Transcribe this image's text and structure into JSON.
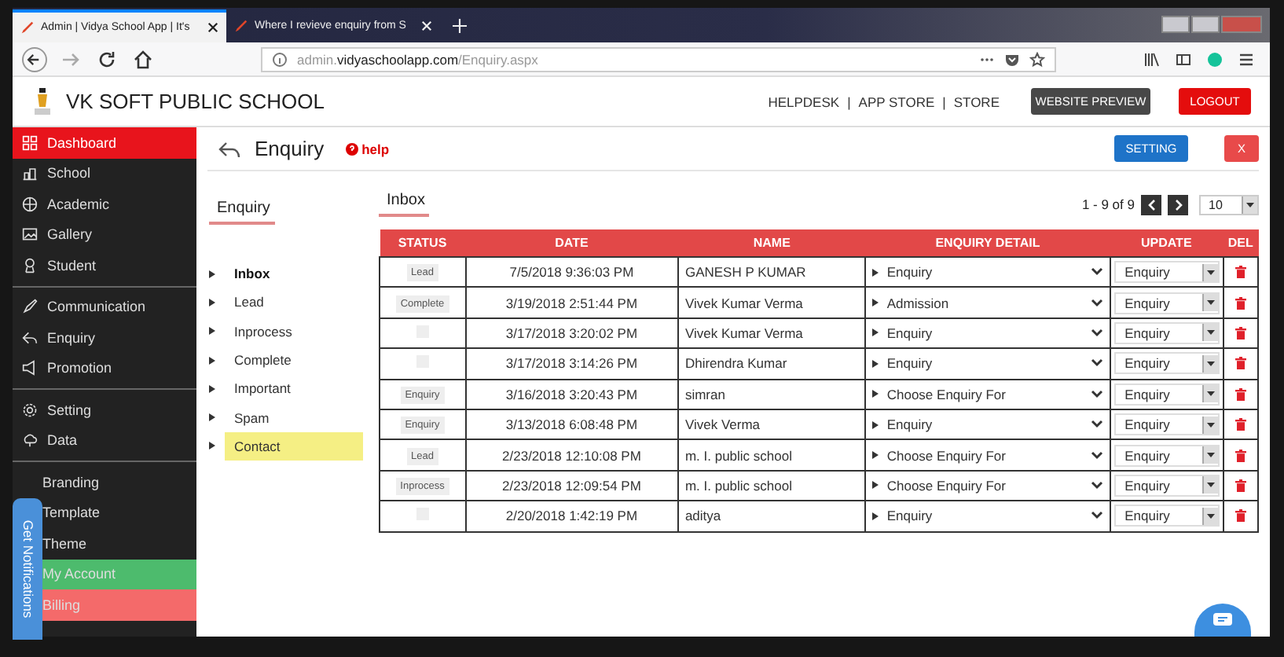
{
  "browser": {
    "tabs": [
      {
        "title": "Admin | Vidya School App | It's",
        "selected": true
      },
      {
        "title": "Where I revieve enquiry from S",
        "selected": false
      }
    ],
    "url": {
      "host": "admin.",
      "domain": "vidyaschoolapp.com",
      "path": "/Enquiry.aspx"
    }
  },
  "header": {
    "school_name": "VK SOFT PUBLIC SCHOOL",
    "links": [
      "HELPDESK",
      "APP STORE",
      "STORE"
    ],
    "separator": "|",
    "preview_button": "WEBSITE PREVIEW",
    "logout_button": "LOGOUT"
  },
  "sidebar": {
    "groups": [
      {
        "items": [
          {
            "label": "Dashboard",
            "selected": true,
            "color": "#e8141c"
          },
          {
            "label": "School",
            "selected": false
          },
          {
            "label": "Academic",
            "selected": false
          },
          {
            "label": "Gallery",
            "selected": false
          },
          {
            "label": "Student",
            "selected": false
          }
        ]
      },
      {
        "items": [
          {
            "label": "Communication",
            "selected": false
          },
          {
            "label": "Enquiry",
            "selected": false
          },
          {
            "label": "Promotion",
            "selected": false
          }
        ]
      },
      {
        "items": [
          {
            "label": "Setting",
            "selected": false
          },
          {
            "label": "Data",
            "selected": false
          }
        ]
      },
      {
        "items": [
          {
            "label": "Branding",
            "selected": false
          },
          {
            "label": "Template",
            "selected": false
          },
          {
            "label": "Theme",
            "selected": false
          },
          {
            "label": "My Account",
            "selected": false,
            "color": "#4dbb6d"
          },
          {
            "label": "Billing",
            "selected": false,
            "color": "#f46a6a"
          }
        ]
      }
    ]
  },
  "notification_tab": "Get Notifications",
  "page": {
    "title": "Enquiry",
    "help": "help",
    "setting_button": "SETTING",
    "close_button": "X"
  },
  "submenu": {
    "title": "Enquiry",
    "items": [
      {
        "label": "Inbox",
        "selected": true,
        "highlighted": false
      },
      {
        "label": "Lead",
        "selected": false,
        "highlighted": false
      },
      {
        "label": "Inprocess",
        "selected": false,
        "highlighted": false
      },
      {
        "label": "Complete",
        "selected": false,
        "highlighted": false
      },
      {
        "label": "Important",
        "selected": false,
        "highlighted": false
      },
      {
        "label": "Spam",
        "selected": false,
        "highlighted": false
      },
      {
        "label": "Contact",
        "selected": false,
        "highlighted": true
      }
    ]
  },
  "inbox": {
    "title": "Inbox",
    "pagination": "1 - 9 of 9",
    "page_size": "10",
    "table": {
      "columns": [
        "STATUS",
        "DATE",
        "NAME",
        "ENQUIRY DETAIL",
        "UPDATE",
        "DEL"
      ],
      "rows": [
        {
          "status": "Lead",
          "date": "7/5/2018 9:36:03 PM",
          "name": "GANESH P KUMAR",
          "detail": "Enquiry",
          "update": "Enquiry"
        },
        {
          "status": "Complete",
          "date": "3/19/2018 2:51:44 PM",
          "name": "Vivek Kumar Verma",
          "detail": "Admission",
          "update": "Enquiry"
        },
        {
          "date": "3/17/2018 3:20:02 PM",
          "name": "Vivek Kumar Verma",
          "detail": "Enquiry",
          "update": "Enquiry"
        },
        {
          "date": "3/17/2018 3:14:26 PM",
          "name": "Dhirendra Kumar",
          "detail": "Enquiry",
          "update": "Enquiry"
        },
        {
          "status": "Enquiry",
          "date": "3/16/2018 3:20:43 PM",
          "name": "simran",
          "detail": "Choose Enquiry For",
          "update": "Enquiry"
        },
        {
          "status": "Enquiry",
          "date": "3/13/2018 6:08:48 PM",
          "name": "Vivek Verma",
          "detail": "Enquiry",
          "update": "Enquiry"
        },
        {
          "status": "Lead",
          "date": "2/23/2018 12:10:08 PM",
          "name": "m. I. public school",
          "detail": "Choose Enquiry For",
          "update": "Enquiry"
        },
        {
          "status": "Inprocess",
          "date": "2/23/2018 12:09:54 PM",
          "name": "m. I. public school",
          "detail": "Choose Enquiry For",
          "update": "Enquiry"
        },
        {
          "date": "2/20/2018 1:42:19 PM",
          "name": "aditya",
          "detail": "Enquiry",
          "update": "Enquiry"
        }
      ]
    }
  }
}
